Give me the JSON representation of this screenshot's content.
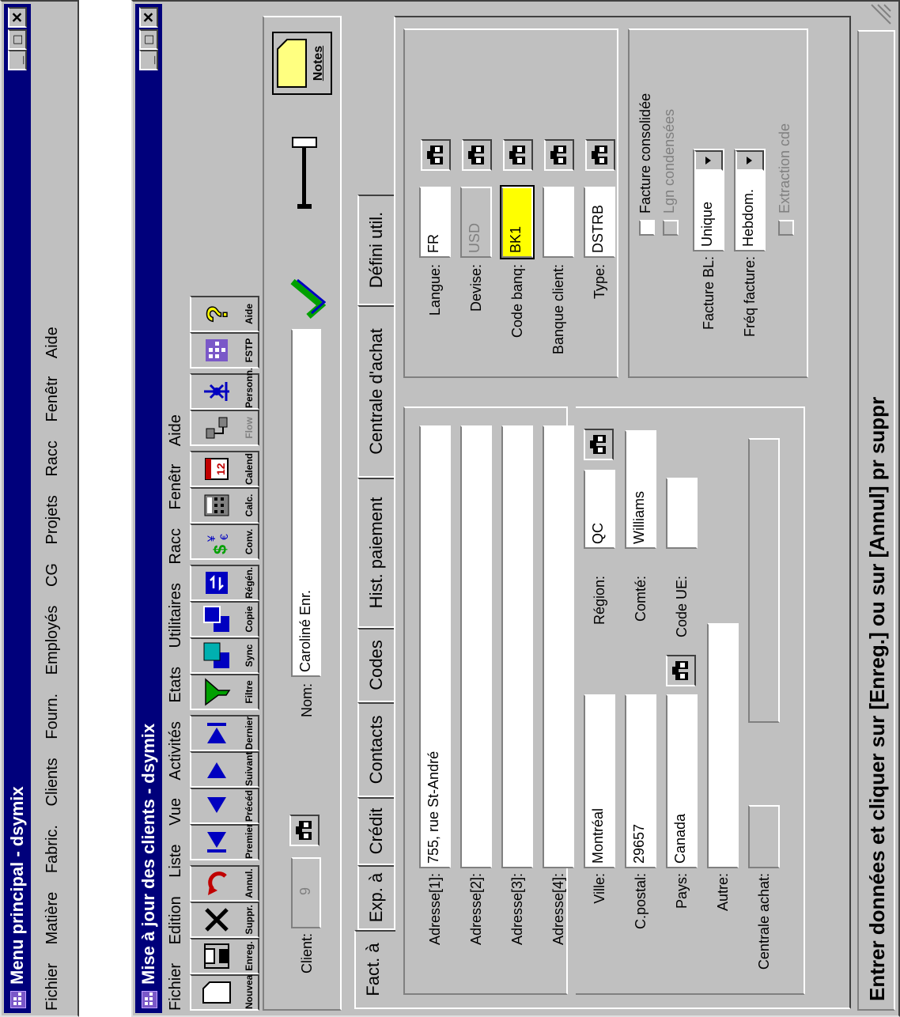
{
  "main_window": {
    "title": "Menu principal - dsymix",
    "menu": [
      "Fichier",
      "Matière",
      "Fabric.",
      "Clients",
      "Fourn.",
      "Employés",
      "CG",
      "Projets",
      "Racc",
      "Fenêtr",
      "Aide"
    ]
  },
  "client_window": {
    "title": "Mise à jour des clients - dsymix",
    "menu": [
      "Fichier",
      "Edition",
      "Liste",
      "Vue",
      "Activités",
      "Etats",
      "Utilitaires",
      "Racc",
      "Fenêtr",
      "Aide"
    ],
    "toolbar": [
      "Nouveau",
      "Enreg.",
      "Suppr.",
      "Annul.",
      "Premier",
      "Précéd",
      "Suivant",
      "Dernier",
      "Filtre",
      "Sync",
      "Copie",
      "Régén.",
      "Conv.",
      "Calc.",
      "Calend",
      "Flow",
      "Personn.",
      "FSTP",
      "Aide"
    ],
    "header": {
      "client_label": "Client:",
      "client_value": "9",
      "nom_label": "Nom:",
      "nom_value": "Caroliné Enr.",
      "notes_label": "Notes"
    },
    "tabs": [
      "Fact. à",
      "Exp. à",
      "Crédit",
      "Contacts",
      "Codes",
      "Hist. paiement",
      "Centrale d'achat",
      "Défini util."
    ],
    "address": {
      "adresse1_label": "Adresse[1]:",
      "adresse1_value": "755, rue St-André",
      "adresse2_label": "Adresse[2]:",
      "adresse2_value": "",
      "adresse3_label": "Adresse[3]:",
      "adresse3_value": "",
      "adresse4_label": "Adresse[4]:",
      "adresse4_value": "",
      "ville_label": "Ville:",
      "ville_value": "Montréal",
      "region_label": "Région:",
      "region_value": "QC",
      "cpostal_label": "C.postal:",
      "cpostal_value": "29657",
      "comte_label": "Comté:",
      "comte_value": "Williams",
      "pays_label": "Pays:",
      "pays_value": "Canada",
      "codeue_label": "Code UE:",
      "codeue_value": "",
      "autre_label": "Autre:",
      "autre_value": "",
      "centrale_label": "Centrale achat:",
      "centrale_value": ""
    },
    "settings": {
      "langue_label": "Langue:",
      "langue_value": "FR",
      "devise_label": "Devise:",
      "devise_value": "USD",
      "codebanq_label": "Code banq:",
      "codebanq_value": "BK1",
      "banque_label": "Banque client:",
      "banque_value": "",
      "type_label": "Type:",
      "type_value": "DSTRB"
    },
    "options": {
      "facture_consolidee": "Facture consolidée",
      "lgn_condensees": "Lgn condensées",
      "facture_bl_label": "Facture BL:",
      "facture_bl_value": "Unique",
      "freq_facture_label": "Fréq facture:",
      "freq_facture_value": "Hebdom.",
      "extraction_cde": "Extraction cde"
    },
    "status": "Entrer données et cliquer sur [Enreg.] ou sur [Annul] pr suppr"
  },
  "colors": {
    "title_bar": "#00007b",
    "highlight_field": "#ffff00",
    "window_face": "#c0c0c0"
  }
}
